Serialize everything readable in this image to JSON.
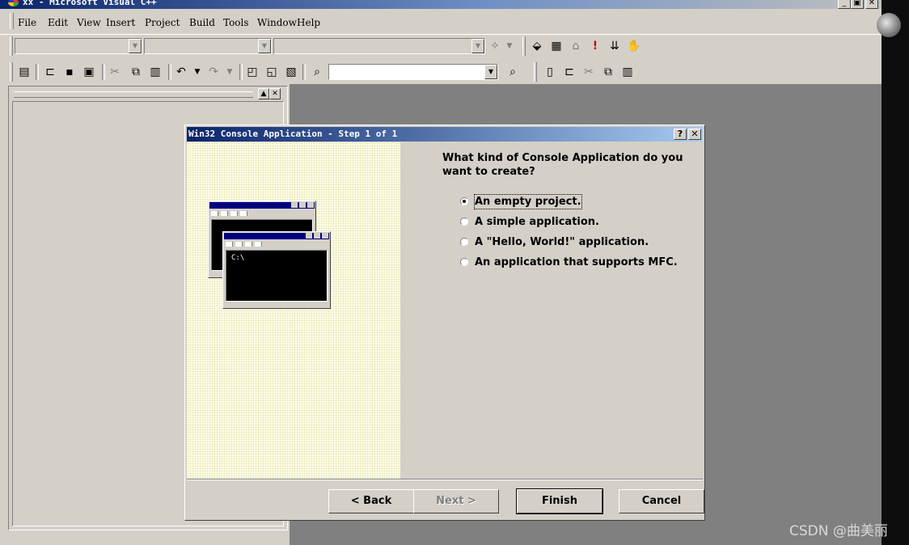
{
  "window": {
    "title": "xx - Microsoft Visual C++",
    "controls": [
      "_",
      "▣",
      "✕"
    ]
  },
  "menubar": {
    "items": [
      "File",
      "Edit",
      "View",
      "Insert",
      "Project",
      "Build",
      "Tools",
      "Window",
      "Help"
    ]
  },
  "toolbar": {
    "find_combo_value": ""
  },
  "dialog": {
    "title": "Win32 Console Application - Step 1 of 1",
    "help_glyph": "?",
    "close_glyph": "✕",
    "illustration": {
      "console_prompt": "C:\\"
    },
    "question": "What kind of Console Application do you want to create?",
    "options": [
      {
        "label": "An empty project.",
        "selected": true
      },
      {
        "label": "A simple application.",
        "selected": false
      },
      {
        "label": "A \"Hello, World!\" application.",
        "selected": false
      },
      {
        "label": "An application that supports MFC.",
        "selected": false
      }
    ],
    "buttons": {
      "back": "< Back",
      "next": "Next >",
      "finish": "Finish",
      "cancel": "Cancel"
    }
  },
  "watermark": "CSDN @曲美丽"
}
